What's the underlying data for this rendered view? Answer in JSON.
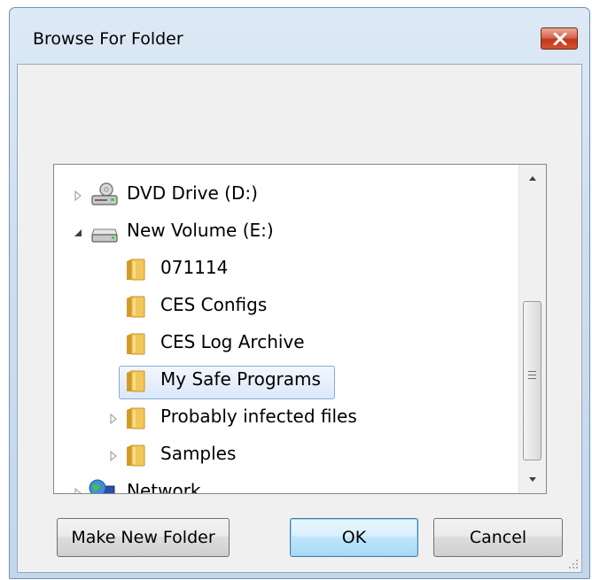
{
  "window": {
    "title": "Browse For Folder"
  },
  "tree": {
    "items": [
      {
        "label": "DVD Drive (D:)",
        "icon": "dvd-drive-icon",
        "expander": "collapsed"
      },
      {
        "label": "New Volume (E:)",
        "icon": "hard-drive-icon",
        "expander": "expanded"
      },
      {
        "label": "071114",
        "icon": "folder-icon",
        "expander": "none"
      },
      {
        "label": "CES Configs",
        "icon": "folder-icon",
        "expander": "none"
      },
      {
        "label": "CES Log Archive",
        "icon": "folder-icon",
        "expander": "none"
      },
      {
        "label": "My Safe Programs",
        "icon": "folder-icon",
        "expander": "none",
        "selected": true
      },
      {
        "label": "Probably infected files",
        "icon": "folder-icon",
        "expander": "collapsed"
      },
      {
        "label": "Samples",
        "icon": "folder-icon",
        "expander": "collapsed"
      },
      {
        "label": "Network",
        "icon": "network-icon",
        "expander": "collapsed"
      }
    ]
  },
  "buttons": {
    "make_new_folder": "Make New Folder",
    "ok": "OK",
    "cancel": "Cancel"
  },
  "colors": {
    "close_button": "#c74a2d",
    "selection_border": "#84acdd",
    "folder": "#e8b84a"
  }
}
